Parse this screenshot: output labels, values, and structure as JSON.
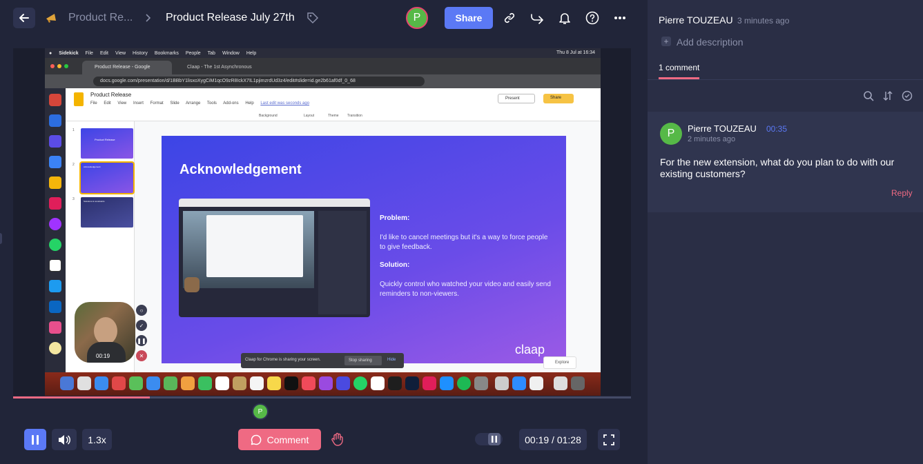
{
  "header": {
    "breadcrumb_parent": "Product Re...",
    "title": "Product Release July 27th",
    "avatar_initial": "P",
    "share_label": "Share"
  },
  "screen": {
    "mac_menu": [
      "Sidekick",
      "File",
      "Edit",
      "View",
      "History",
      "Bookmarks",
      "People",
      "Tab",
      "Window",
      "Help"
    ],
    "clock": "Thu 8 Jul at 16:34",
    "browser_tabs": [
      "Product Release - Google",
      "Claap - The 1st Asynchronous"
    ],
    "url": "docs.google.com/presentation/d/1BBbY1lisxoXygCiM1qcO9zR8IckX7IL1pjimzrdUd3z4/edit#slide=id.ge2b61af0df_0_68",
    "doc_title": "Product Release",
    "doc_menu": [
      "File",
      "Edit",
      "View",
      "Insert",
      "Format",
      "Slide",
      "Arrange",
      "Tools",
      "Add-ons",
      "Help"
    ],
    "last_edit": "Last edit was seconds ago",
    "present_label": "Present",
    "docs_share_label": "Share",
    "toolbar": [
      "Background",
      "Layout",
      "Theme",
      "Transition"
    ],
    "thumbnails": [
      {
        "num": "1",
        "label": "Product Release"
      },
      {
        "num": "2",
        "label": "Acknowledgement"
      },
      {
        "num": "3",
        "label": "Solutions & constraints"
      }
    ],
    "slide": {
      "title": "Acknowledgement",
      "problem_label": "Problem:",
      "problem_text": "I'd like to cancel meetings but it's a way to force people to give feedback.",
      "solution_label": "Solution:",
      "solution_text": "Quickly control who watched your video and easily send reminders to non-viewers.",
      "brand": "claap"
    },
    "sharing_text": "Claap for Chrome is sharing your screen.",
    "stop_sharing": "Stop sharing",
    "hide": "Hide",
    "explore": "Explore",
    "dock_date": "8",
    "webcam_time": "00:19"
  },
  "player": {
    "progress": 0.221,
    "marker_initial": "P",
    "speed": "1.3x",
    "comment_label": "Comment",
    "time": "00:19 / 01:28"
  },
  "panel": {
    "author": "Pierre TOUZEAU",
    "author_time": "3 minutes ago",
    "add_description": "Add description",
    "comments_tab": "1 comment",
    "comments": [
      {
        "initial": "P",
        "author": "Pierre TOUZEAU",
        "timestamp": "00:35",
        "time": "2 minutes ago",
        "text": "For the new extension, what do you plan to do with our existing customers?",
        "reply": "Reply"
      }
    ]
  },
  "colors": {
    "accent_blue": "#5b79f5",
    "accent_pink": "#ef6a83",
    "avatar_green": "#56b947",
    "panel_bg": "#2a2e45",
    "page_bg": "#212539"
  }
}
